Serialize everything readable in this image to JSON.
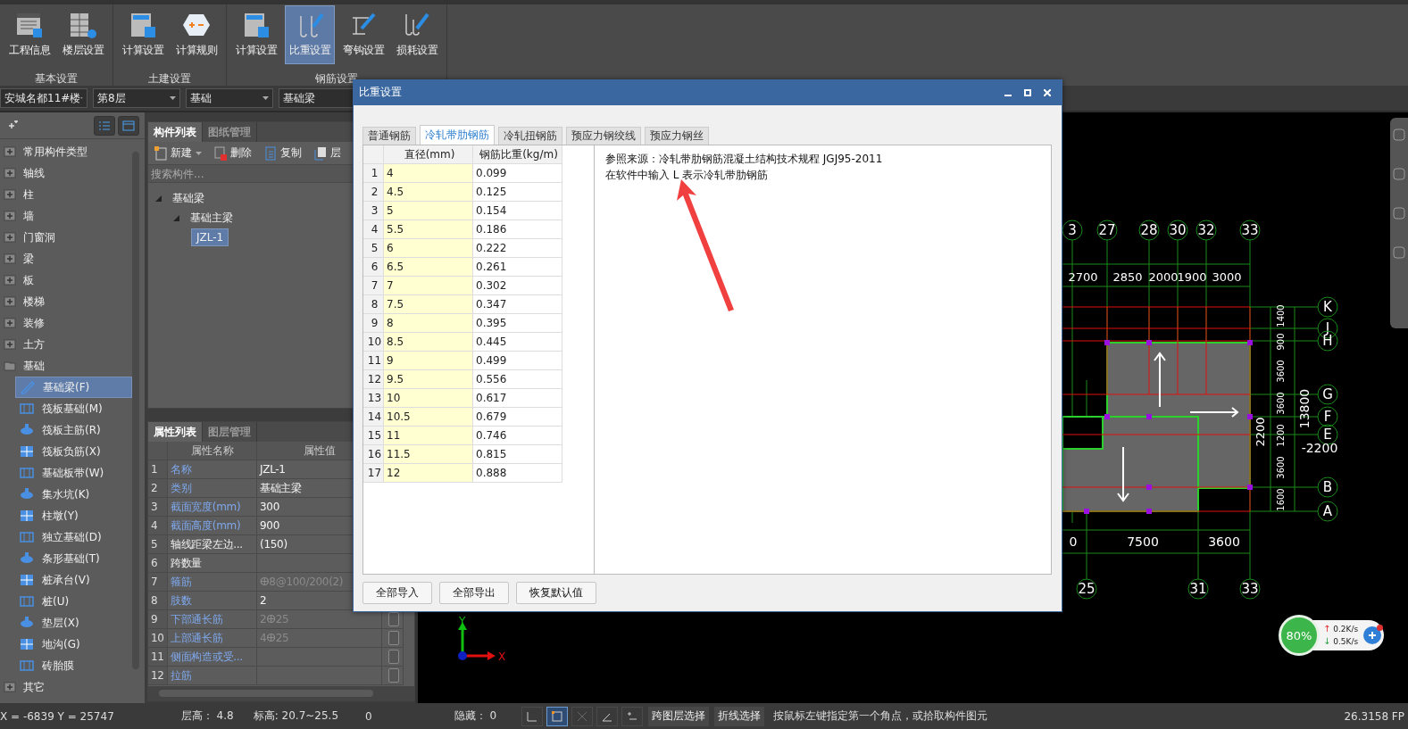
{
  "ribbon": {
    "groups": [
      {
        "label": "基本设置",
        "buttons": [
          {
            "label": "工程信息",
            "selected": false
          },
          {
            "label": "楼层设置",
            "selected": false
          }
        ]
      },
      {
        "label": "土建设置",
        "buttons": [
          {
            "label": "计算设置",
            "selected": false
          },
          {
            "label": "计算规则",
            "selected": false
          }
        ]
      },
      {
        "label": "钢筋设置",
        "buttons": [
          {
            "label": "计算设置",
            "selected": false
          },
          {
            "label": "比重设置",
            "selected": true
          },
          {
            "label": "弯钩设置",
            "selected": false
          },
          {
            "label": "损耗设置",
            "selected": false
          }
        ]
      }
    ]
  },
  "selectors": [
    "安城名都11#楼",
    "第8层",
    "基础",
    "基础梁"
  ],
  "sidebar": {
    "items": [
      {
        "label": "常用构件类型",
        "expanded": false
      },
      {
        "label": "轴线",
        "expanded": false
      },
      {
        "label": "柱",
        "expanded": false
      },
      {
        "label": "墙",
        "expanded": false
      },
      {
        "label": "门窗洞",
        "expanded": false
      },
      {
        "label": "梁",
        "expanded": false
      },
      {
        "label": "板",
        "expanded": false
      },
      {
        "label": "楼梯",
        "expanded": false
      },
      {
        "label": "装修",
        "expanded": false
      },
      {
        "label": "土方",
        "expanded": false
      },
      {
        "label": "基础",
        "expanded": true,
        "children": [
          {
            "label": "基础梁(F)",
            "selected": true
          },
          {
            "label": "筏板基础(M)",
            "selected": false
          },
          {
            "label": "筏板主筋(R)",
            "selected": false
          },
          {
            "label": "筏板负筋(X)",
            "selected": false
          },
          {
            "label": "基础板带(W)",
            "selected": false
          },
          {
            "label": "集水坑(K)",
            "selected": false
          },
          {
            "label": "柱墩(Y)",
            "selected": false
          },
          {
            "label": "独立基础(D)",
            "selected": false
          },
          {
            "label": "条形基础(T)",
            "selected": false
          },
          {
            "label": "桩承台(V)",
            "selected": false
          },
          {
            "label": "桩(U)",
            "selected": false
          },
          {
            "label": "垫层(X)",
            "selected": false
          },
          {
            "label": "地沟(G)",
            "selected": false
          },
          {
            "label": "砖胎膜",
            "selected": false
          }
        ]
      },
      {
        "label": "其它",
        "expanded": false
      }
    ]
  },
  "component_panel": {
    "tabs": [
      {
        "label": "构件列表",
        "selected": true
      },
      {
        "label": "图纸管理",
        "selected": false
      }
    ],
    "toolbar": [
      "新建",
      "删除",
      "复制",
      "层"
    ],
    "search": {
      "placeholder": "搜索构件..."
    },
    "tree": [
      {
        "label": "基础梁",
        "expanded": true,
        "children": [
          {
            "label": "基础主梁",
            "expanded": true,
            "children": [
              {
                "label": "JZL-1",
                "selected": true
              }
            ]
          }
        ]
      }
    ]
  },
  "property_panel": {
    "tabs": [
      {
        "label": "属性列表",
        "selected": true
      },
      {
        "label": "图层管理",
        "selected": false
      }
    ],
    "columns": [
      "属性名称",
      "属性值"
    ],
    "rows": [
      {
        "index": "1",
        "name": "名称",
        "value": "JZL-1",
        "public": true,
        "dim": false
      },
      {
        "index": "2",
        "name": "类别",
        "value": "基础主梁",
        "public": true,
        "dim": false
      },
      {
        "index": "3",
        "name": "截面宽度(mm)",
        "value": "300",
        "public": true,
        "dim": false
      },
      {
        "index": "4",
        "name": "截面高度(mm)",
        "value": "900",
        "public": true,
        "dim": false
      },
      {
        "index": "5",
        "name": "轴线距梁左边...",
        "value": "(150)",
        "public": false,
        "dim": false
      },
      {
        "index": "6",
        "name": "跨数量",
        "public": false
      },
      {
        "index": "7",
        "name": "箍筋",
        "value": "ⴲ8@100/200(2)",
        "public": true,
        "dim": true
      },
      {
        "index": "8",
        "name": "肢数",
        "value": "2",
        "public": true,
        "dim": false
      },
      {
        "index": "9",
        "name": "下部通长筋",
        "value": "2ⴲ25",
        "public": true,
        "dim": true,
        "checked": false
      },
      {
        "index": "10",
        "name": "上部通长筋",
        "value": "4ⴲ25",
        "public": true,
        "dim": true,
        "checked": false
      },
      {
        "index": "11",
        "name": "侧面构造或受...",
        "public": true,
        "checked": false
      },
      {
        "index": "12",
        "name": "拉筋",
        "public": true,
        "checked": false
      }
    ]
  },
  "canvas": {
    "top_axes": [
      "3",
      "27",
      "28",
      "30",
      "32",
      "33"
    ],
    "top_dims": [
      "2700",
      "2850",
      "2000",
      "1900",
      "3000"
    ],
    "right_axes": [
      "K",
      "J",
      "H",
      "G",
      "F",
      "E",
      "B",
      "A"
    ],
    "right_dims": [
      "1600",
      "3600",
      "1200",
      "3600",
      "3600",
      "900",
      "1400"
    ],
    "total_dim": "13800",
    "side_dims": [
      "2200",
      "-2200"
    ],
    "bottom_dims": [
      "0",
      "7500",
      "3600"
    ],
    "bottom_axes": [
      "25",
      "31",
      "33"
    ],
    "axis_labels": [
      "Y",
      "X"
    ]
  },
  "dialog": {
    "title": "比重设置",
    "tabs": [
      {
        "label": "普通钢筋",
        "selected": false
      },
      {
        "label": "冷轧带肋钢筋",
        "selected": true
      },
      {
        "label": "冷轧扭钢筋",
        "selected": false
      },
      {
        "label": "预应力钢绞线",
        "selected": false
      },
      {
        "label": "预应力钢丝",
        "selected": false
      }
    ],
    "table": {
      "columns": [
        "",
        "直径(mm)",
        "钢筋比重(kg/m)"
      ],
      "rows": [
        [
          "1",
          "4",
          "0.099"
        ],
        [
          "2",
          "4.5",
          "0.125"
        ],
        [
          "3",
          "5",
          "0.154"
        ],
        [
          "4",
          "5.5",
          "0.186"
        ],
        [
          "5",
          "6",
          "0.222"
        ],
        [
          "6",
          "6.5",
          "0.261"
        ],
        [
          "7",
          "7",
          "0.302"
        ],
        [
          "8",
          "7.5",
          "0.347"
        ],
        [
          "9",
          "8",
          "0.395"
        ],
        [
          "10",
          "8.5",
          "0.445"
        ],
        [
          "11",
          "9",
          "0.499"
        ],
        [
          "12",
          "9.5",
          "0.556"
        ],
        [
          "13",
          "10",
          "0.617"
        ],
        [
          "14",
          "10.5",
          "0.679"
        ],
        [
          "15",
          "11",
          "0.746"
        ],
        [
          "16",
          "11.5",
          "0.815"
        ],
        [
          "17",
          "12",
          "0.888"
        ]
      ]
    },
    "notes": [
      "参照来源：冷轧带肋钢筋混凝土结构技术规程 JGJ95-2011",
      "在软件中输入 L 表示冷轧带肋钢筋"
    ],
    "buttons": [
      "全部导入",
      "全部导出",
      "恢复默认值"
    ]
  },
  "network": {
    "percent": "80%",
    "upload_arrow": "↑",
    "upload": "0.2K/s",
    "download_arrow": "↓",
    "download": "0.5K/s"
  },
  "status_bar": {
    "coords": "X = -6839 Y = 25747",
    "floor_height": "层高： 4.8",
    "elevation": "标高: 20.7~25.5",
    "count": "0",
    "hidden": "隐藏： 0",
    "tools": [
      {
        "selected": false
      },
      {
        "selected": true
      },
      {
        "selected": false
      },
      {
        "selected": false
      },
      {
        "selected": false
      }
    ],
    "buttons": [
      "跨图层选择",
      "折线选择"
    ],
    "message": "按鼠标左键指定第一个角点，或拾取构件图元",
    "fps": "26.3158 FP"
  }
}
